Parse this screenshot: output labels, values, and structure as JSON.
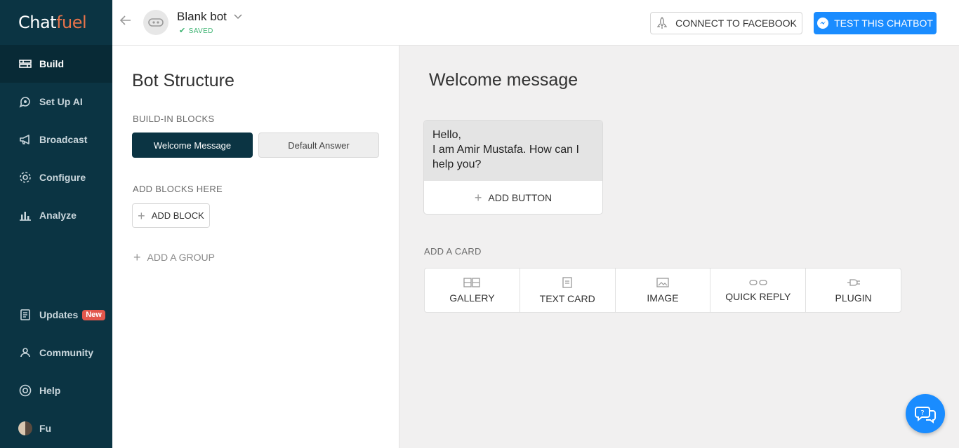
{
  "brand": {
    "logo_part1": "Chat",
    "logo_part2": "fuel",
    "accent": "#e8734a",
    "sidebar_bg": "#0b3443"
  },
  "sidebar": {
    "items": [
      {
        "label": "Build",
        "icon": "build-icon",
        "active": true
      },
      {
        "label": "Set Up AI",
        "icon": "ai-icon"
      },
      {
        "label": "Broadcast",
        "icon": "megaphone-icon"
      },
      {
        "label": "Configure",
        "icon": "gear-icon"
      },
      {
        "label": "Analyze",
        "icon": "bar-chart-icon"
      }
    ],
    "bottom_items": [
      {
        "label": "Updates",
        "icon": "updates-icon",
        "badge": "New"
      },
      {
        "label": "Community",
        "icon": "community-icon"
      },
      {
        "label": "Help",
        "icon": "lifebuoy-icon"
      },
      {
        "label": "Fu",
        "icon": "user-avatar"
      }
    ]
  },
  "topbar": {
    "bot_name": "Blank bot",
    "saved_status": "SAVED",
    "connect_label": "CONNECT TO FACEBOOK",
    "test_label": "TEST THIS CHATBOT",
    "test_color": "#1a8cff"
  },
  "structure": {
    "title": "Bot Structure",
    "builtin_label": "BUILD-IN BLOCKS",
    "builtin_blocks": [
      "Welcome Message",
      "Default Answer"
    ],
    "add_blocks_label": "ADD BLOCKS HERE",
    "add_block_label": "ADD BLOCK",
    "add_group_label": "ADD A GROUP"
  },
  "main": {
    "title": "Welcome message",
    "message_text": "Hello,\nI am Amir Mustafa. How can I help you?",
    "add_button_label": "ADD BUTTON",
    "add_card_label": "ADD A CARD",
    "cards": [
      {
        "label": "GALLERY",
        "icon": "gallery-icon"
      },
      {
        "label": "TEXT CARD",
        "icon": "text-card-icon"
      },
      {
        "label": "IMAGE",
        "icon": "image-icon"
      },
      {
        "label": "QUICK REPLY",
        "icon": "quick-reply-icon"
      },
      {
        "label": "PLUGIN",
        "icon": "plugin-icon"
      }
    ]
  }
}
